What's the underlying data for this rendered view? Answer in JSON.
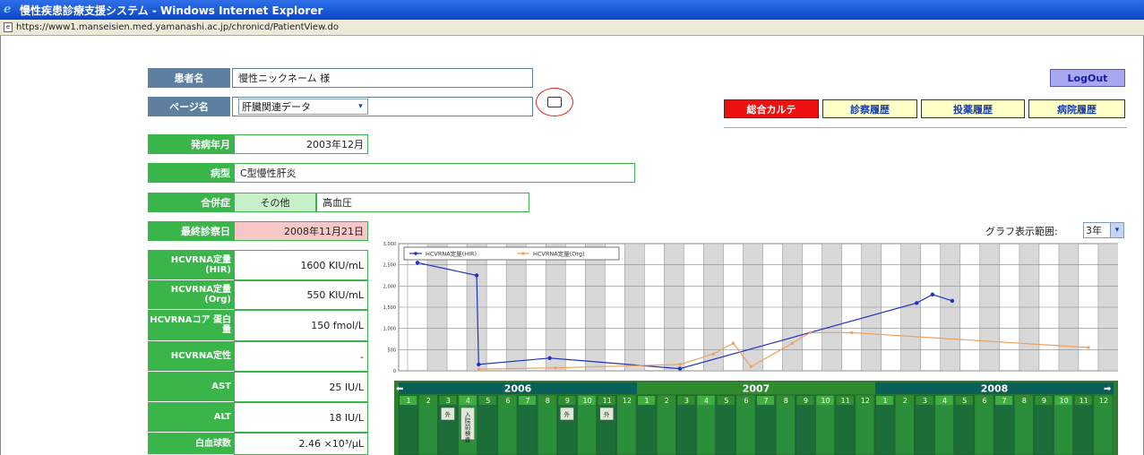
{
  "window": {
    "title": "慢性疾患診療支援システム - Windows Internet Explorer"
  },
  "address": {
    "url": "https://www1.manseisien.med.yamanashi.ac.jp/chronicd/PatientView.do"
  },
  "header": {
    "patient_label": "患者名",
    "patient_value": "慢性ニックネーム 様",
    "page_label": "ページ名",
    "page_select": "肝臓関連データ",
    "logout": "LogOut"
  },
  "tabs": [
    {
      "label": "総合カルテ",
      "bg": "#ee1111",
      "fg": "#ffffff"
    },
    {
      "label": "診察履歴",
      "bg": "#ffffc8",
      "fg": "#1a3fa8"
    },
    {
      "label": "投薬履歴",
      "bg": "#ffffc8",
      "fg": "#1a3fa8"
    },
    {
      "label": "病院履歴",
      "bg": "#ffffc8",
      "fg": "#1a3fa8"
    }
  ],
  "info": {
    "onset_label": "発病年月",
    "onset_value": "2003年12月",
    "type_label": "病型",
    "type_value": "C型慢性肝炎",
    "comp_label": "合併症",
    "comp_sub": "その他",
    "comp_value": "高血圧",
    "last_label": "最終診察日",
    "last_value": "2008年11月21日"
  },
  "labs": [
    {
      "label": "HCVRNA定量 (HIR)",
      "value": "1600 KIU/mL"
    },
    {
      "label": "HCVRNA定量 (Org)",
      "value": "550 KIU/mL"
    },
    {
      "label": "HCVRNAコア 蛋白量",
      "value": "150 fmol/L"
    },
    {
      "label": "HCVRNA定性",
      "value": "-"
    },
    {
      "label": "AST",
      "value": "25 IU/L"
    },
    {
      "label": "ALT",
      "value": "18 IU/L"
    },
    {
      "label": "白血球数",
      "value": "2.46 ×10³/μL"
    }
  ],
  "range": {
    "label": "グラフ表示範囲:",
    "value": "3年"
  },
  "chart_data": {
    "type": "line",
    "yticks": [
      "3,000",
      "2,500",
      "2,000",
      "1,500",
      "1,000",
      "500",
      "0"
    ],
    "ylim": [
      0,
      3000
    ],
    "series": [
      {
        "name": "HCVRNA定量(HIR)",
        "color": "#2233bb",
        "points": [
          [
            0.5,
            2550
          ],
          [
            3.5,
            2250
          ],
          [
            3.6,
            150
          ],
          [
            7.2,
            300
          ],
          [
            13.8,
            50
          ],
          [
            25.8,
            1600
          ],
          [
            26.6,
            1800
          ],
          [
            27.6,
            1650
          ]
        ]
      },
      {
        "name": "HCVRNA定量(Org)",
        "color": "#f0a060",
        "points": [
          [
            3.6,
            40
          ],
          [
            7.5,
            70
          ],
          [
            13.8,
            150
          ],
          [
            15.5,
            400
          ],
          [
            16.5,
            650
          ],
          [
            17.4,
            100
          ],
          [
            19.5,
            650
          ],
          [
            20.4,
            900
          ],
          [
            22.5,
            900
          ],
          [
            34.5,
            550
          ]
        ]
      }
    ]
  },
  "timeline": {
    "years": [
      "2006",
      "2007",
      "2008"
    ],
    "months": [
      "1",
      "2",
      "3",
      "4",
      "5",
      "6",
      "7",
      "8",
      "9",
      "10",
      "11",
      "12",
      "1",
      "2",
      "3",
      "4",
      "5",
      "6",
      "7",
      "8",
      "9",
      "10",
      "11",
      "12",
      "1",
      "2",
      "3",
      "4",
      "5",
      "6",
      "7",
      "8",
      "9",
      "10",
      "11",
      "12"
    ],
    "prev_arrow": "⬅",
    "next_arrow": "➡",
    "markers": [
      {
        "month_index": 2,
        "text": "外"
      },
      {
        "month_index": 3,
        "text": "入院前検査"
      },
      {
        "month_index": 8,
        "text": "外"
      },
      {
        "month_index": 10,
        "text": "外"
      }
    ]
  }
}
